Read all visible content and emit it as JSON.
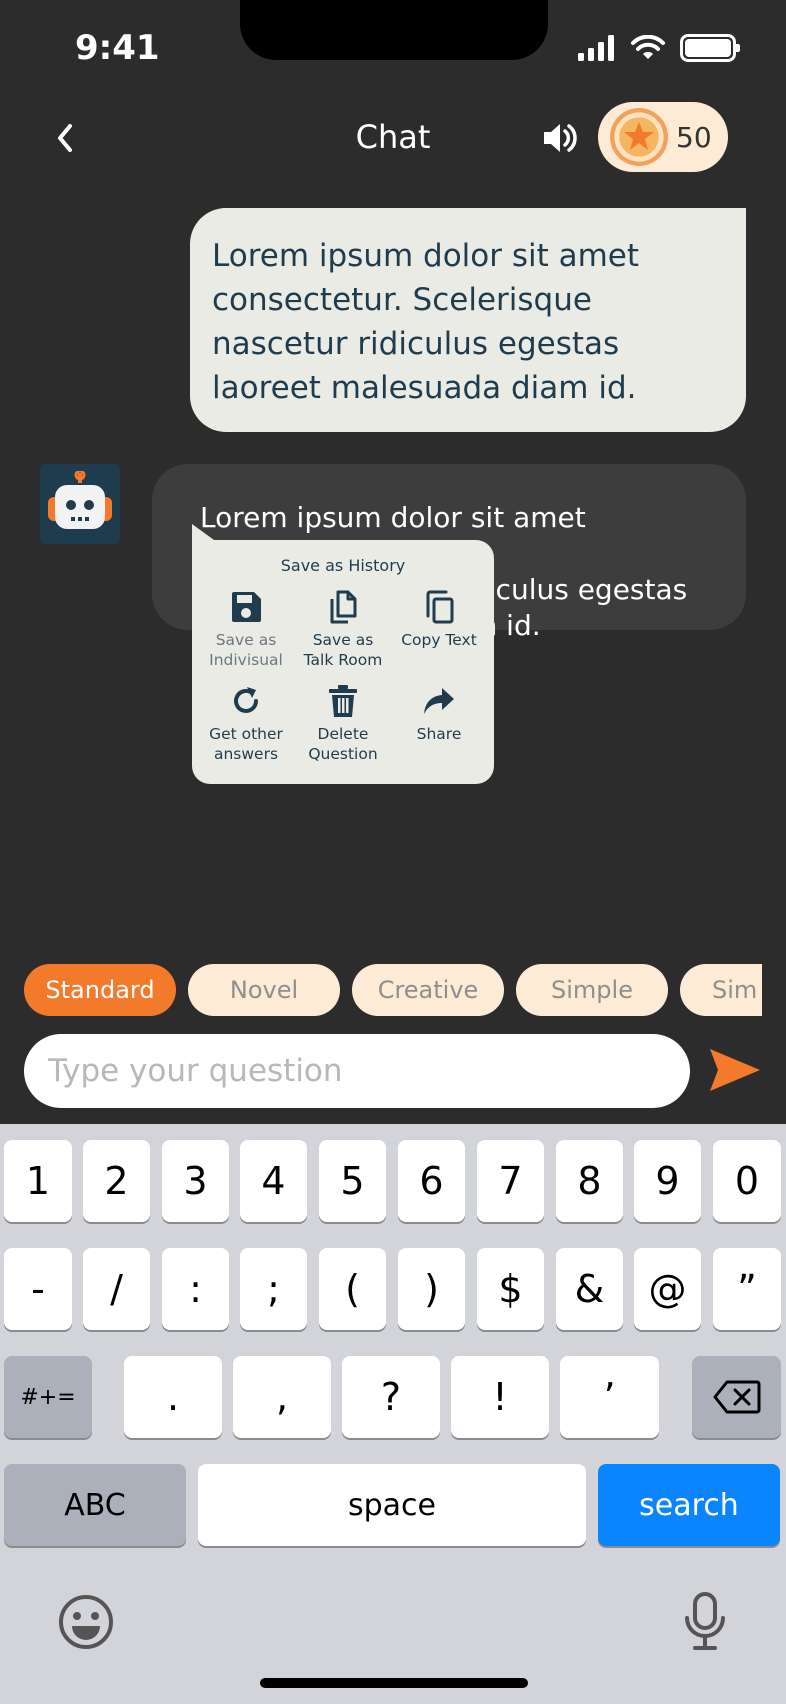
{
  "status_bar": {
    "time": "9:41"
  },
  "header": {
    "title": "Chat",
    "coins": "50"
  },
  "messages": {
    "user": "Lorem ipsum dolor sit amet consectetur. Scelerisque nascetur ridiculus egestas laoreet malesuada diam id.",
    "bot_visible_line1": "Lorem ipsum dolor sit amet consectetur.",
    "bot_visible_line2": "diculus egestas",
    "bot_visible_line3": "m id."
  },
  "context_menu": {
    "title": "Save as History",
    "items": [
      {
        "label_1": "Save as",
        "label_2": "Indivisual",
        "icon": "floppy-disk-icon"
      },
      {
        "label_1": "Save as",
        "label_2": "Talk Room",
        "icon": "files-icon"
      },
      {
        "label_1": "Copy Text",
        "label_2": "",
        "icon": "copy-icon"
      },
      {
        "label_1": "Get other",
        "label_2": "answers",
        "icon": "refresh-icon"
      },
      {
        "label_1": "Delete",
        "label_2": "Question",
        "icon": "trash-icon"
      },
      {
        "label_1": "Share",
        "label_2": "",
        "icon": "share-icon"
      }
    ]
  },
  "style_chips": [
    "Standard",
    "Novel",
    "Creative",
    "Simple",
    "Sim"
  ],
  "input": {
    "placeholder": "Type your question"
  },
  "keyboard": {
    "row1": [
      "1",
      "2",
      "3",
      "4",
      "5",
      "6",
      "7",
      "8",
      "9",
      "0"
    ],
    "row2": [
      "-",
      "/",
      ":",
      ";",
      "(",
      ")",
      "$",
      "&",
      "@",
      "”"
    ],
    "row3": [
      "#+=",
      ".",
      ",",
      "?",
      "!",
      "’"
    ],
    "abc": "ABC",
    "space": "space",
    "search": "search"
  },
  "colors": {
    "background": "#2c2c2c",
    "accent": "#f47a2b",
    "chip": "#fdebd6",
    "navy": "#1f3c4e",
    "keyboard_blue": "#0a84ff"
  }
}
